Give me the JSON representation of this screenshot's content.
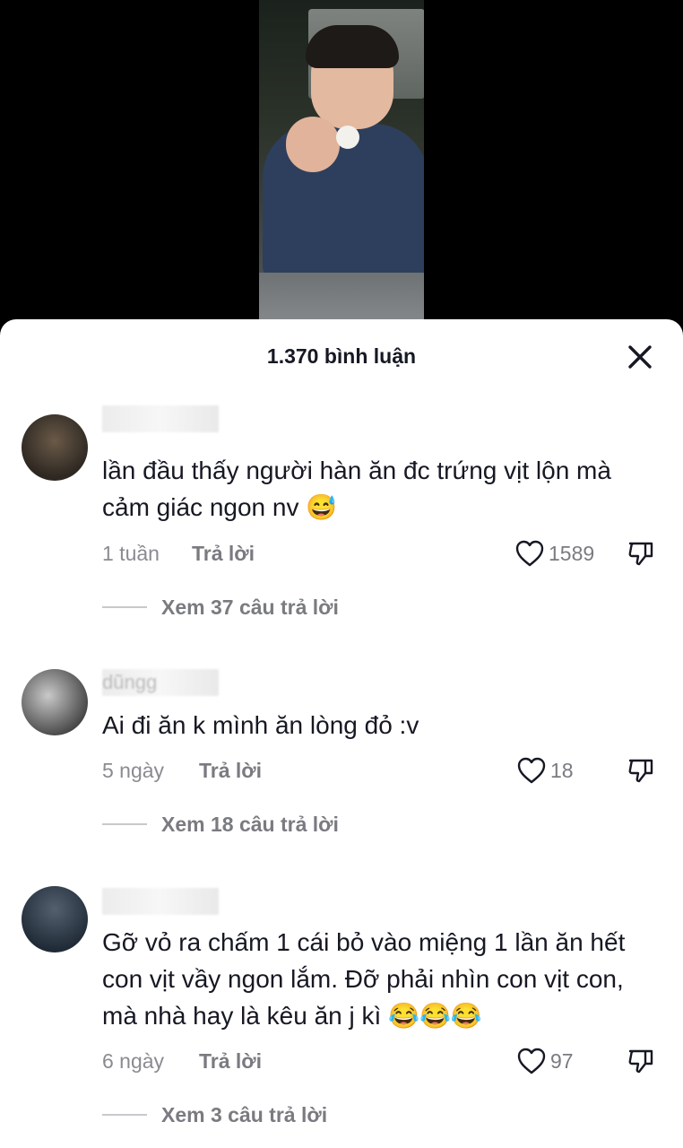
{
  "header": {
    "title": "1.370 bình luận"
  },
  "comments": [
    {
      "username": "",
      "text": "lần đầu thấy người hàn ăn đc trứng vịt lộn mà cảm giác ngon nv 😅",
      "time": "1 tuần",
      "reply_label": "Trả lời",
      "likes": "1589",
      "view_replies": "Xem 37 câu trả lời"
    },
    {
      "username": "dũngg",
      "text": "Ai đi ăn k mình ăn lòng đỏ :v",
      "time": "5 ngày",
      "reply_label": "Trả lời",
      "likes": "18",
      "view_replies": "Xem 18 câu trả lời"
    },
    {
      "username": "",
      "text": "Gỡ vỏ ra chấm 1 cái bỏ vào miệng 1 lần ăn hết con vịt vầy ngon lắm. Đỡ phải nhìn con vịt con, mà nhà hay là kêu ăn j kì 😂😂😂",
      "time": "6 ngày",
      "reply_label": "Trả lời",
      "likes": "97",
      "view_replies": "Xem 3 câu trả lời"
    }
  ]
}
